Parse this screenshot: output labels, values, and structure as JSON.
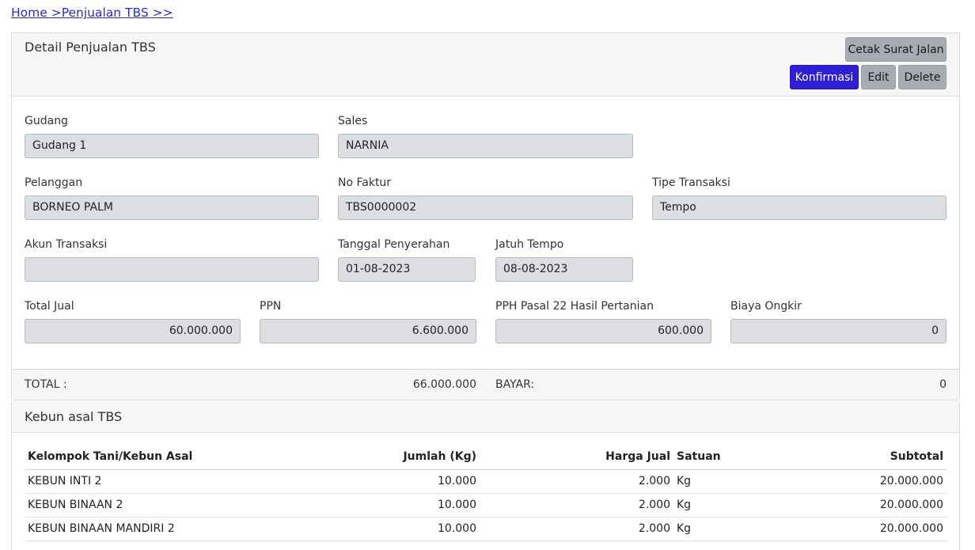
{
  "breadcrumb": "Home >Penjualan TBS >>",
  "detail": {
    "title": "Detail Penjualan TBS",
    "buttons": {
      "cetak": "Cetak Surat Jalan",
      "konfirmasi": "Konfirmasi",
      "edit": "Edit",
      "delete": "Delete"
    },
    "fields": {
      "gudang": {
        "label": "Gudang",
        "value": "Gudang 1"
      },
      "sales": {
        "label": "Sales",
        "value": "NARNIA"
      },
      "pelanggan": {
        "label": "Pelanggan",
        "value": "BORNEO PALM"
      },
      "no_faktur": {
        "label": "No Faktur",
        "value": "TBS0000002"
      },
      "tipe_transaksi": {
        "label": "Tipe Transaksi",
        "value": "Tempo"
      },
      "akun_transaksi": {
        "label": "Akun Transaksi",
        "value": ""
      },
      "tanggal_penyerahan": {
        "label": "Tanggal Penyerahan",
        "value": "01-08-2023"
      },
      "jatuh_tempo": {
        "label": "Jatuh Tempo",
        "value": "08-08-2023"
      },
      "total_jual": {
        "label": "Total Jual",
        "value": "60.000.000"
      },
      "ppn": {
        "label": "PPN",
        "value": "6.600.000"
      },
      "pph": {
        "label": "PPH Pasal 22 Hasil Pertanian",
        "value": "600.000"
      },
      "biaya_ongkir": {
        "label": "Biaya Ongkir",
        "value": "0"
      }
    },
    "footer": {
      "total_label": "TOTAL :",
      "total_value": "66.000.000",
      "bayar_label": "BAYAR:",
      "bayar_value": "0"
    }
  },
  "kebun": {
    "title": "Kebun asal TBS",
    "columns": [
      "Kelompok Tani/Kebun Asal",
      "Jumlah (Kg)",
      "Harga Jual",
      "Satuan",
      "Subtotal"
    ],
    "rows": [
      [
        "KEBUN INTI 2",
        "10.000",
        "2.000",
        "Kg",
        "20.000.000"
      ],
      [
        "KEBUN BINAAN 2",
        "10.000",
        "2.000",
        "Kg",
        "20.000.000"
      ],
      [
        "KEBUN BINAAN MANDIRI 2",
        "10.000",
        "2.000",
        "Kg",
        "20.000.000"
      ]
    ]
  }
}
